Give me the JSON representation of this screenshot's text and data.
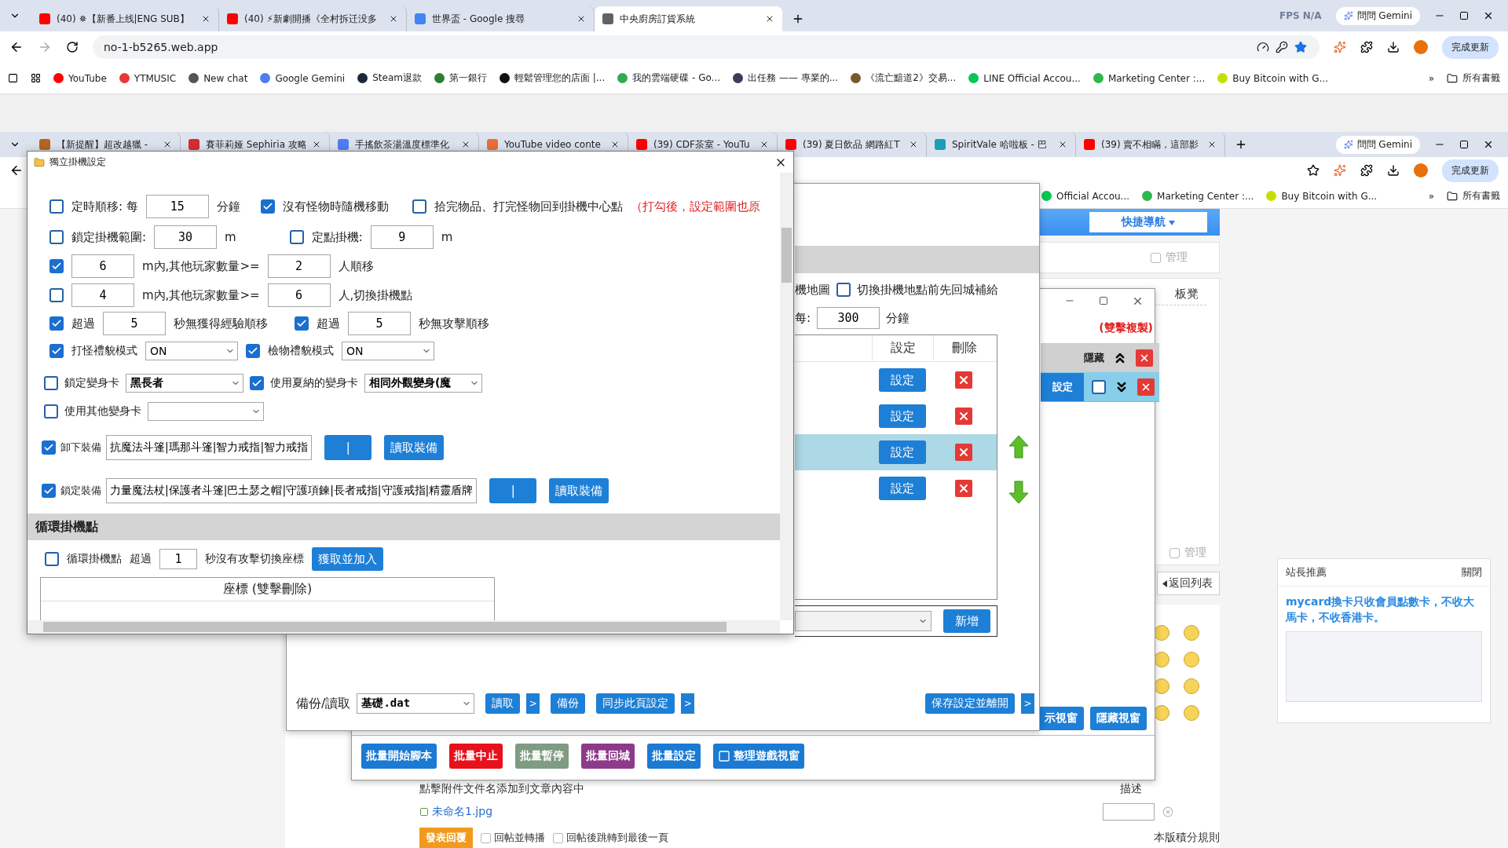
{
  "browser_top": {
    "tabs": [
      {
        "title": "(40) ✵【新番上线|ENG SUB】",
        "color": "#ff0000",
        "selected": false
      },
      {
        "title": "(40) ⚡新劇開播《全村拆迁没多",
        "color": "#ff0000",
        "selected": false
      },
      {
        "title": "世界盃 - Google 搜尋",
        "color": "#4285f4",
        "selected": false
      },
      {
        "title": "中央廚房訂貨系統",
        "color": "#5f6368",
        "selected": true
      }
    ],
    "overlay": "FPS N/A",
    "gemini": "問問 Gemini",
    "address": "no-1-b5265.web.app",
    "update": "完成更新",
    "bookmarks": [
      {
        "label": "YouTube",
        "color": "#ff0000"
      },
      {
        "label": "YTMUSIC",
        "color": "#e53935"
      },
      {
        "label": "New chat",
        "color": "#555555"
      },
      {
        "label": "Google Gemini",
        "color": "#4f7df3"
      },
      {
        "label": "Steam退款",
        "color": "#1b2838"
      },
      {
        "label": "第一銀行",
        "color": "#2e7d32"
      },
      {
        "label": "輕鬆管理您的店面 |...",
        "color": "#111111"
      },
      {
        "label": "我的雲端硬碟 - Go...",
        "color": "#34a853"
      },
      {
        "label": "出任務 —— 專業的...",
        "color": "#3c3c5a"
      },
      {
        "label": "《流亡黯道2》交易...",
        "color": "#7a5a2a"
      },
      {
        "label": "LINE Official Accou...",
        "color": "#06c755"
      },
      {
        "label": "Marketing Center :...",
        "color": "#2fb84f"
      },
      {
        "label": "Buy Bitcoin with G...",
        "color": "#c5e000"
      }
    ],
    "more": "»",
    "all_bookmarks": "所有書籤"
  },
  "browser_back": {
    "tabs": [
      {
        "title": "【新提醒】超改越獵 -",
        "color": "#b5651d",
        "selected": false
      },
      {
        "title": "賽菲莉娅 Sephiria 攻略",
        "color": "#d32f2f",
        "selected": false
      },
      {
        "title": "手搖飲茶湯溫度標準化",
        "color": "#4f7df3",
        "selected": false
      },
      {
        "title": "YouTube video conte",
        "color": "#e8703a",
        "selected": false
      },
      {
        "title": "(39) CDF茶室 - YouTu",
        "color": "#ff0000",
        "selected": false
      },
      {
        "title": "(39) 夏日飲品 網路紅T",
        "color": "#ff0000",
        "selected": false
      },
      {
        "title": "SpiritVale 哈啦板 - 巴",
        "color": "#1a9fb5",
        "selected": false
      },
      {
        "title": "(39) 賣不相瞞，這部影",
        "color": "#ff0000",
        "selected": false
      }
    ],
    "gemini": "問問 Gemini",
    "update": "完成更新",
    "bookmarks": [
      {
        "label": "Official Accou...",
        "color": "#06c755"
      },
      {
        "label": "Marketing Center :...",
        "color": "#2fb84f"
      },
      {
        "label": "Buy Bitcoin with G...",
        "color": "#c5e000"
      }
    ],
    "more": "»",
    "all_bookmarks": "所有書籤"
  },
  "forum": {
    "nav_button": "快捷導航",
    "manage_top": {
      "label": "管理",
      "checked": false
    },
    "floor": "板凳",
    "manage_bottom": {
      "label": "管理",
      "checked": false
    },
    "back_to_list": "返回列表",
    "attach_hint": "點擊附件文件名添加到文章內容中",
    "description": "描述",
    "attachment": "未命名1.jpg",
    "reply_button": "發表回覆",
    "options": [
      {
        "label": "回帖並轉播",
        "checked": false
      },
      {
        "label": "回帖後跳轉到最後一頁",
        "checked": false
      }
    ],
    "rules": "本版積分規則"
  },
  "recommend": {
    "title": "站長推薦",
    "close": "關閉",
    "text": "mycard換卡只收會員點數卡，不收大馬卡，不收香港卡。"
  },
  "batch_window": {
    "copy_hint": "(雙擊複製)",
    "hide_label": "隱藏",
    "set_button": "設定",
    "row_checked": false,
    "show_button": "示視窗",
    "hide_button": "隱藏視窗",
    "batch_buttons": [
      {
        "label": "批量開始腳本",
        "color": "#1a7ad4"
      },
      {
        "label": "批量中止",
        "color": "#e8101a"
      },
      {
        "label": "批量暫停",
        "color": "#7f9c83"
      },
      {
        "label": "批量回城",
        "color": "#8e3a8a"
      },
      {
        "label": "批量設定",
        "color": "#1a7ad4"
      },
      {
        "label": "整理遊戲視窗",
        "color": "#1a7ad4"
      }
    ]
  },
  "settings_window": {
    "map_label": "機地圖",
    "return_first": {
      "label": "切換掛機地點前先回城補給",
      "checked": false
    },
    "interval_label": "每:",
    "interval": "300",
    "interval_unit": "分鐘",
    "columns": [
      "設定",
      "刪除"
    ],
    "rows": [
      {
        "button": "設定",
        "selected": false
      },
      {
        "button": "設定",
        "selected": false
      },
      {
        "button": "設定",
        "selected": true
      },
      {
        "button": "設定",
        "selected": false
      }
    ],
    "add_button": "新增",
    "backup_label": "備份/讀取",
    "file": "基礎.dat",
    "actions": [
      {
        "label": "讀取",
        "more": ">"
      },
      {
        "label": "備份"
      },
      {
        "label": "同步此頁設定",
        "more": ">"
      },
      {
        "label": "保存設定並離開",
        "more": ">"
      }
    ]
  },
  "dialog": {
    "title": "獨立掛機設定",
    "timed_move": {
      "checked": false,
      "label": "定時順移: 每",
      "value": "15",
      "unit": "分鐘"
    },
    "random_move": {
      "checked": true,
      "label": "沒有怪物時隨機移動"
    },
    "return_center": {
      "checked": false,
      "label": "拾完物品、打完怪物回到掛機中心點",
      "note": "（打勾後，設定範圍也原"
    },
    "lock_range": {
      "checked": false,
      "label": "鎖定掛機範圍:",
      "value": "30",
      "unit": "m"
    },
    "fixed_point": {
      "checked": false,
      "label": "定點掛機:",
      "value": "9",
      "unit": "m"
    },
    "player_rules": [
      {
        "checked": true,
        "distance": "6",
        "middle": "m內,其他玩家數量>=",
        "count": "2",
        "action": "人順移"
      },
      {
        "checked": false,
        "distance": "4",
        "middle": "m內,其他玩家數量>=",
        "count": "6",
        "action": "人,切換掛機點"
      }
    ],
    "timeouts": [
      {
        "checked": true,
        "label": "超過",
        "value": "5",
        "unit": "秒無獲得經驗順移"
      },
      {
        "checked": true,
        "label": "超過",
        "value": "5",
        "unit": "秒無攻擊順移"
      }
    ],
    "modes": [
      {
        "checked": true,
        "label": "打怪禮貌模式",
        "value": "ON"
      },
      {
        "checked": true,
        "label": "檢物禮貌模式",
        "value": "ON"
      }
    ],
    "cards": [
      {
        "checked": false,
        "label": "鎖定變身卡",
        "value": "黑長者"
      },
      {
        "checked": true,
        "label": "使用夏納的變身卡",
        "value": "相同外觀變身(魔"
      }
    ],
    "other_card": {
      "checked": false,
      "label": "使用其他變身卡"
    },
    "equipment": [
      {
        "checked": true,
        "label": "卸下裝備",
        "value": "抗魔法斗篷|瑪那斗篷|智力戒指|智力戒指",
        "separator": "|",
        "read_button": "讀取裝備"
      },
      {
        "checked": true,
        "label": "鎖定裝備",
        "value": "力量魔法杖|保護者斗篷|巴土瑟之帽|守護項鍊|長者戒指|守護戒指|精靈盾牌",
        "separator": "|",
        "read_button": "讀取裝備"
      }
    ],
    "cycle": {
      "heading": "循環掛機點",
      "checked": false,
      "label": "循環掛機點",
      "prefix": "超過",
      "value": "1",
      "suffix": "秒沒有攻擊切換座標",
      "add_button": "獲取並加入",
      "table_header": "座標 (雙擊刪除)"
    }
  }
}
